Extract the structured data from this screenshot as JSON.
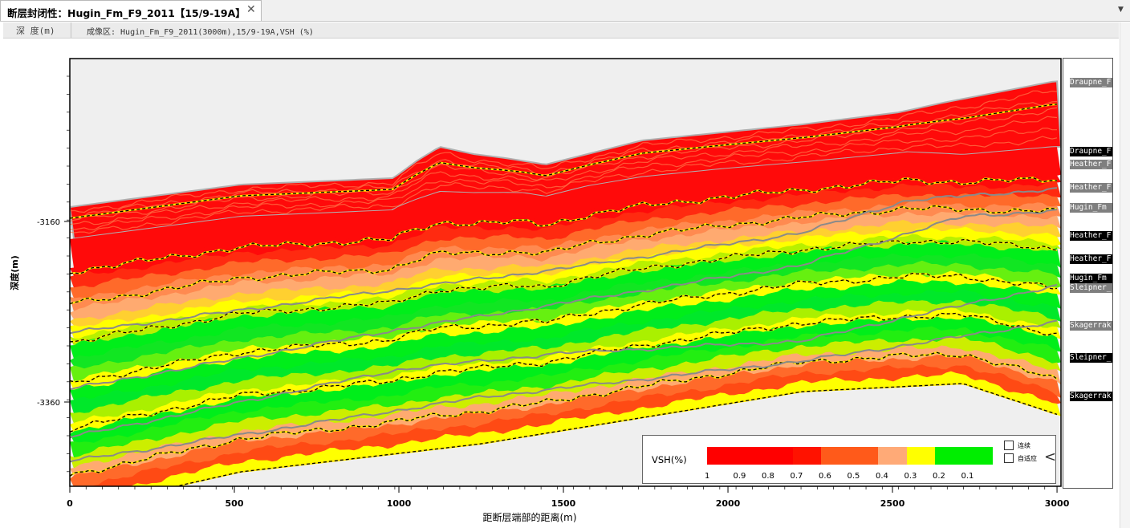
{
  "tab": {
    "title": "断层封闭性：Hugin_Fm_F9_2011【15/9-19A】",
    "close": "✕",
    "menu": "▼"
  },
  "header": {
    "depth_label": "深 度(m)",
    "image_label": "成像区: Hugin_Fm_F9_2011(3000m),15/9-19A,VSH (%)"
  },
  "chart_data": {
    "type": "heatmap",
    "xlabel": "距断层端部的距离(m)",
    "ylabel": "深度(m)",
    "x_ticks": [
      "0",
      "500",
      "1000",
      "1500",
      "2000",
      "2500",
      "3000"
    ],
    "y_ticks": [
      "-3160",
      "-3160",
      "-3360"
    ],
    "xlim": [
      0,
      3000
    ],
    "colors": {
      "background": "#efefef",
      "red": "#ff0a0a",
      "orange": "#ff6a2a",
      "salmon": "#ffaa70",
      "yellow": "#ffff00",
      "green": "#00ee1a"
    }
  },
  "legend": {
    "title": "VSH(%)",
    "labels": [
      "1",
      "0.9",
      "0.8",
      "0.7",
      "0.6",
      "0.5",
      "0.4",
      "0.3",
      "0.2",
      "0.1"
    ],
    "colors": [
      "#ff0000",
      "#ff0000",
      "#ff0000",
      "#ff1200",
      "#ff5a1a",
      "#ff5a1a",
      "#ffaa77",
      "#ffff00",
      "#00ee00",
      "#00ee00"
    ],
    "checkbox1": "连续",
    "checkbox2": "自适应",
    "collapse": "<"
  },
  "wells": [
    {
      "label": "Draupne_F",
      "style": "g"
    },
    {
      "label": "Draupne_F",
      "style": "k"
    },
    {
      "label": "Heather_F",
      "style": "g"
    },
    {
      "label": "Heather_F",
      "style": "g"
    },
    {
      "label": "Hugin_Fm",
      "style": "g"
    },
    {
      "label": "Heather_F",
      "style": "k"
    },
    {
      "label": "Heather_F",
      "style": "k"
    },
    {
      "label": "Hugin_Fm",
      "style": "k"
    },
    {
      "label": "Sleipner_",
      "style": "g"
    },
    {
      "label": "Skagerrak",
      "style": "g"
    },
    {
      "label": "Sleipner_",
      "style": "k"
    },
    {
      "label": "Skagerrak",
      "style": "k"
    }
  ]
}
